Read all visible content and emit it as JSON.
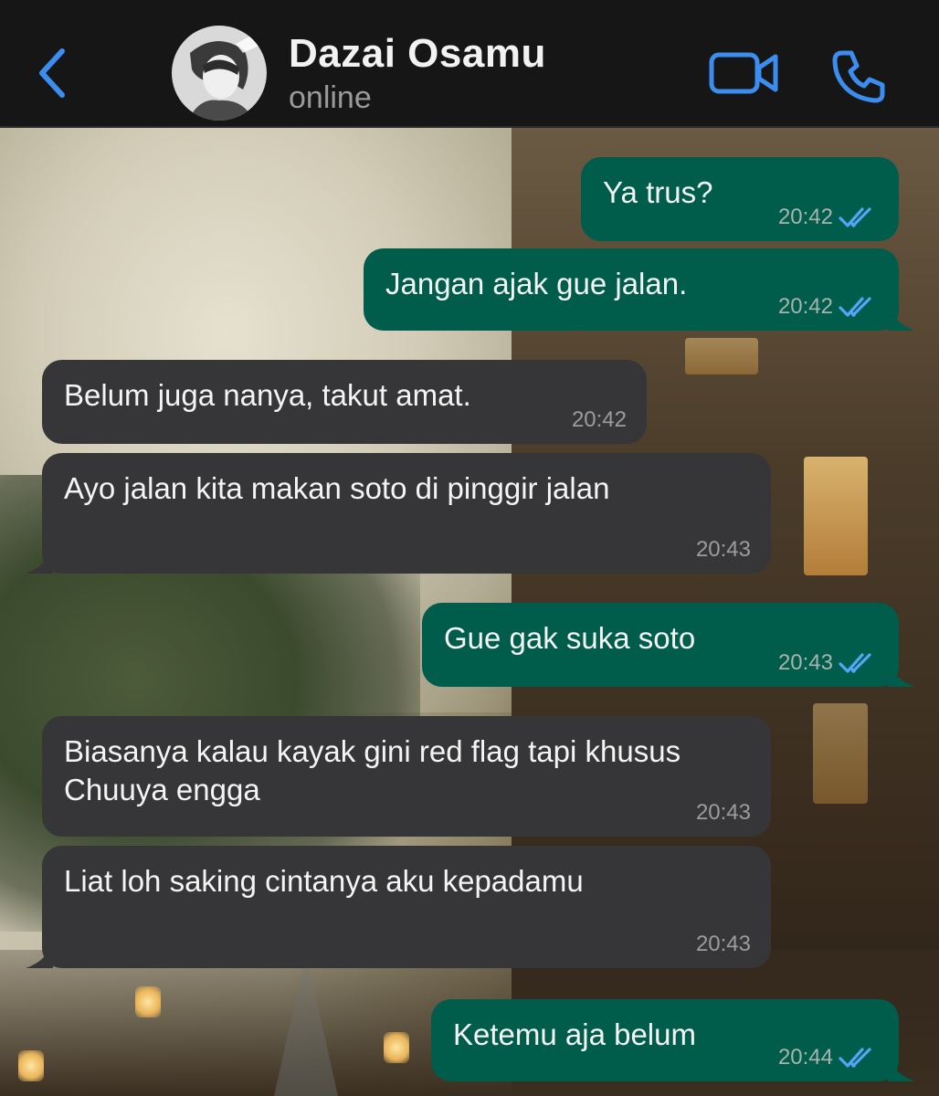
{
  "header": {
    "contact_name": "Dazai Osamu",
    "status": "online",
    "back_icon": "chevron-left-icon",
    "video_icon": "video-camera-icon",
    "call_icon": "phone-icon",
    "accent_color": "#3b8ef0"
  },
  "messages": [
    {
      "direction": "outgoing",
      "text": "Ya trus?",
      "time": "20:42",
      "read": true
    },
    {
      "direction": "outgoing",
      "text": "Jangan ajak gue jalan.",
      "time": "20:42",
      "read": true
    },
    {
      "direction": "incoming",
      "text": "Belum juga nanya, takut amat.",
      "time": "20:42"
    },
    {
      "direction": "incoming",
      "text": "Ayo jalan kita makan soto di pinggir jalan",
      "time": "20:43"
    },
    {
      "direction": "outgoing",
      "text": "Gue gak suka soto",
      "time": "20:43",
      "read": true
    },
    {
      "direction": "incoming",
      "text": "Biasanya kalau kayak gini red flag tapi khusus Chuuya engga",
      "time": "20:43"
    },
    {
      "direction": "incoming",
      "text": "Liat loh saking cintanya aku kepadamu",
      "time": "20:43"
    },
    {
      "direction": "outgoing",
      "text": "Ketemu aja belum",
      "time": "20:44",
      "read": true
    }
  ],
  "colors": {
    "outgoing_bubble": "#005c4b",
    "incoming_bubble": "#363638",
    "read_ticks": "#53a6f5"
  }
}
